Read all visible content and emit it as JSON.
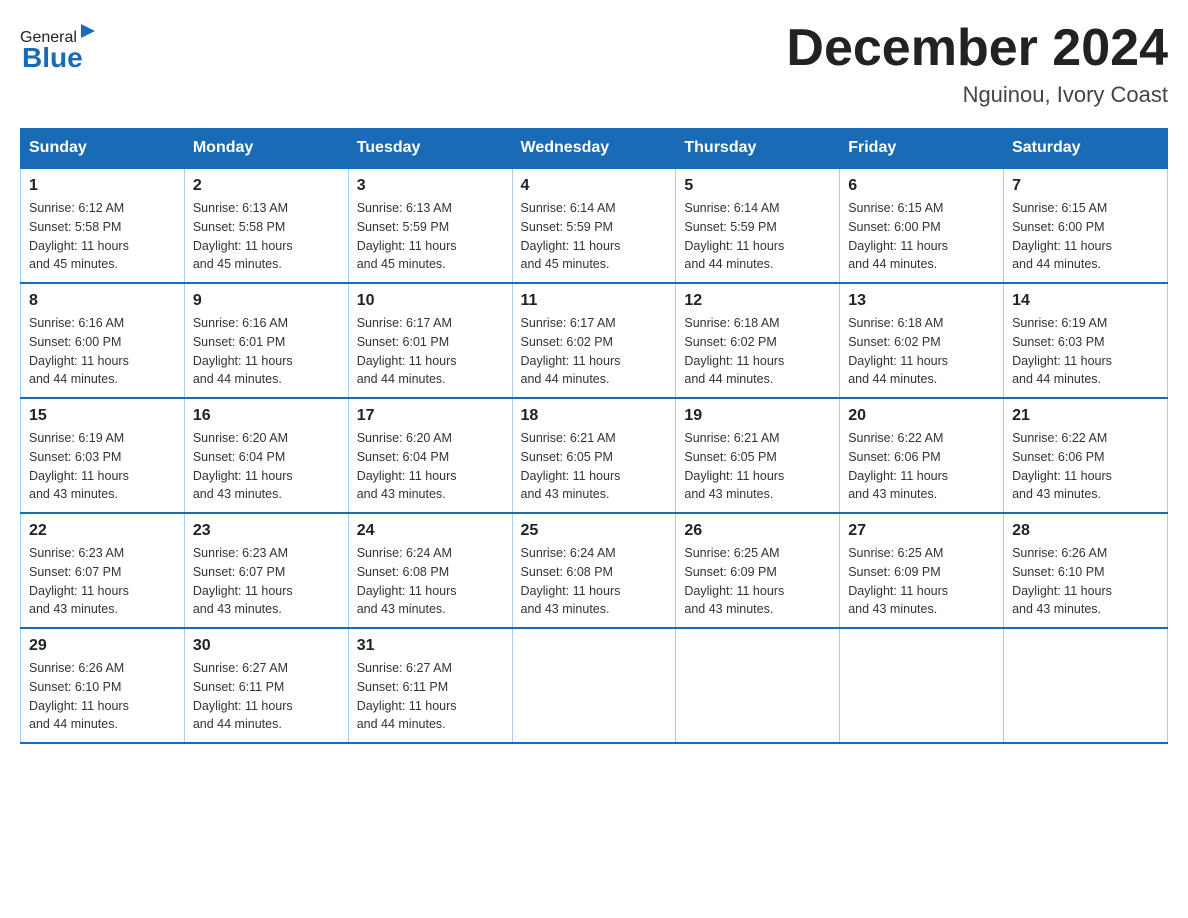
{
  "header": {
    "logo_general": "General",
    "logo_blue": "Blue",
    "month_title": "December 2024",
    "location": "Nguinou, Ivory Coast"
  },
  "weekdays": [
    "Sunday",
    "Monday",
    "Tuesday",
    "Wednesday",
    "Thursday",
    "Friday",
    "Saturday"
  ],
  "weeks": [
    [
      {
        "day": "1",
        "sunrise": "6:12 AM",
        "sunset": "5:58 PM",
        "daylight": "11 hours and 45 minutes."
      },
      {
        "day": "2",
        "sunrise": "6:13 AM",
        "sunset": "5:58 PM",
        "daylight": "11 hours and 45 minutes."
      },
      {
        "day": "3",
        "sunrise": "6:13 AM",
        "sunset": "5:59 PM",
        "daylight": "11 hours and 45 minutes."
      },
      {
        "day": "4",
        "sunrise": "6:14 AM",
        "sunset": "5:59 PM",
        "daylight": "11 hours and 45 minutes."
      },
      {
        "day": "5",
        "sunrise": "6:14 AM",
        "sunset": "5:59 PM",
        "daylight": "11 hours and 44 minutes."
      },
      {
        "day": "6",
        "sunrise": "6:15 AM",
        "sunset": "6:00 PM",
        "daylight": "11 hours and 44 minutes."
      },
      {
        "day": "7",
        "sunrise": "6:15 AM",
        "sunset": "6:00 PM",
        "daylight": "11 hours and 44 minutes."
      }
    ],
    [
      {
        "day": "8",
        "sunrise": "6:16 AM",
        "sunset": "6:00 PM",
        "daylight": "11 hours and 44 minutes."
      },
      {
        "day": "9",
        "sunrise": "6:16 AM",
        "sunset": "6:01 PM",
        "daylight": "11 hours and 44 minutes."
      },
      {
        "day": "10",
        "sunrise": "6:17 AM",
        "sunset": "6:01 PM",
        "daylight": "11 hours and 44 minutes."
      },
      {
        "day": "11",
        "sunrise": "6:17 AM",
        "sunset": "6:02 PM",
        "daylight": "11 hours and 44 minutes."
      },
      {
        "day": "12",
        "sunrise": "6:18 AM",
        "sunset": "6:02 PM",
        "daylight": "11 hours and 44 minutes."
      },
      {
        "day": "13",
        "sunrise": "6:18 AM",
        "sunset": "6:02 PM",
        "daylight": "11 hours and 44 minutes."
      },
      {
        "day": "14",
        "sunrise": "6:19 AM",
        "sunset": "6:03 PM",
        "daylight": "11 hours and 44 minutes."
      }
    ],
    [
      {
        "day": "15",
        "sunrise": "6:19 AM",
        "sunset": "6:03 PM",
        "daylight": "11 hours and 43 minutes."
      },
      {
        "day": "16",
        "sunrise": "6:20 AM",
        "sunset": "6:04 PM",
        "daylight": "11 hours and 43 minutes."
      },
      {
        "day": "17",
        "sunrise": "6:20 AM",
        "sunset": "6:04 PM",
        "daylight": "11 hours and 43 minutes."
      },
      {
        "day": "18",
        "sunrise": "6:21 AM",
        "sunset": "6:05 PM",
        "daylight": "11 hours and 43 minutes."
      },
      {
        "day": "19",
        "sunrise": "6:21 AM",
        "sunset": "6:05 PM",
        "daylight": "11 hours and 43 minutes."
      },
      {
        "day": "20",
        "sunrise": "6:22 AM",
        "sunset": "6:06 PM",
        "daylight": "11 hours and 43 minutes."
      },
      {
        "day": "21",
        "sunrise": "6:22 AM",
        "sunset": "6:06 PM",
        "daylight": "11 hours and 43 minutes."
      }
    ],
    [
      {
        "day": "22",
        "sunrise": "6:23 AM",
        "sunset": "6:07 PM",
        "daylight": "11 hours and 43 minutes."
      },
      {
        "day": "23",
        "sunrise": "6:23 AM",
        "sunset": "6:07 PM",
        "daylight": "11 hours and 43 minutes."
      },
      {
        "day": "24",
        "sunrise": "6:24 AM",
        "sunset": "6:08 PM",
        "daylight": "11 hours and 43 minutes."
      },
      {
        "day": "25",
        "sunrise": "6:24 AM",
        "sunset": "6:08 PM",
        "daylight": "11 hours and 43 minutes."
      },
      {
        "day": "26",
        "sunrise": "6:25 AM",
        "sunset": "6:09 PM",
        "daylight": "11 hours and 43 minutes."
      },
      {
        "day": "27",
        "sunrise": "6:25 AM",
        "sunset": "6:09 PM",
        "daylight": "11 hours and 43 minutes."
      },
      {
        "day": "28",
        "sunrise": "6:26 AM",
        "sunset": "6:10 PM",
        "daylight": "11 hours and 43 minutes."
      }
    ],
    [
      {
        "day": "29",
        "sunrise": "6:26 AM",
        "sunset": "6:10 PM",
        "daylight": "11 hours and 44 minutes."
      },
      {
        "day": "30",
        "sunrise": "6:27 AM",
        "sunset": "6:11 PM",
        "daylight": "11 hours and 44 minutes."
      },
      {
        "day": "31",
        "sunrise": "6:27 AM",
        "sunset": "6:11 PM",
        "daylight": "11 hours and 44 minutes."
      },
      null,
      null,
      null,
      null
    ]
  ],
  "labels": {
    "sunrise": "Sunrise:",
    "sunset": "Sunset:",
    "daylight": "Daylight:"
  }
}
